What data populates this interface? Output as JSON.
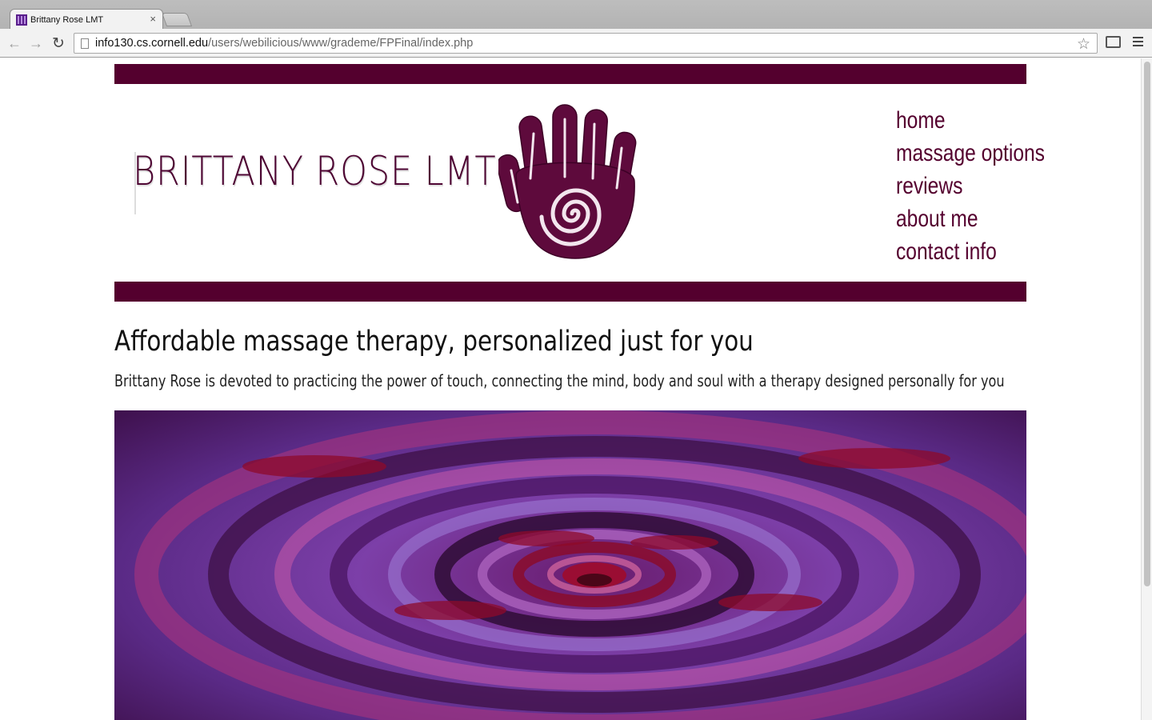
{
  "browser": {
    "tab_title": "Brittany Rose LMT",
    "tab_close": "×",
    "url_host": "info130.cs.cornell.edu",
    "url_path": "/users/webilicious/www/grademe/FPFinal/index.php",
    "back_icon": "←",
    "forward_icon": "→",
    "reload_icon": "↻",
    "star_icon": "☆"
  },
  "site": {
    "logo_text": "BRITTANY ROSE LMT",
    "emblem": "spiral-hand-icon",
    "brand_color": "#54002e",
    "nav": [
      {
        "label": "home"
      },
      {
        "label": "massage options"
      },
      {
        "label": "reviews"
      },
      {
        "label": "about me"
      },
      {
        "label": "contact info"
      }
    ]
  },
  "main": {
    "headline": "Affordable massage therapy, personalized just for you",
    "subtext": "Brittany Rose is devoted to practicing the power of touch, connecting the mind, body and soul with a therapy designed personally for you",
    "hero_image": "water-ripple-photo"
  }
}
